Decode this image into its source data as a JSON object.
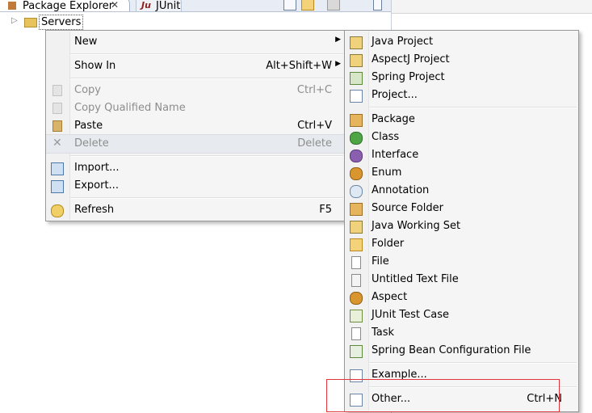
{
  "tabs": {
    "package_explorer": "Package Explorer",
    "close": "✕",
    "junit_badge": "Ju",
    "junit": "JUnit"
  },
  "tree": {
    "expander": "▷",
    "node": "Servers"
  },
  "context_menu": {
    "new": "New",
    "show_in": "Show In",
    "show_in_accel": "Alt+Shift+W",
    "copy": "Copy",
    "copy_accel": "Ctrl+C",
    "copy_qualified_name": "Copy Qualified Name",
    "paste": "Paste",
    "paste_accel": "Ctrl+V",
    "delete": "Delete",
    "delete_accel": "Delete",
    "import": "Import...",
    "export": "Export...",
    "refresh": "Refresh",
    "refresh_accel": "F5",
    "arrow": "▶"
  },
  "new_submenu": {
    "items": [
      "Java Project",
      "AspectJ Project",
      "Spring Project",
      "Project...",
      "Package",
      "Class",
      "Interface",
      "Enum",
      "Annotation",
      "Source Folder",
      "Java Working Set",
      "Folder",
      "File",
      "Untitled Text File",
      "Aspect",
      "JUnit Test Case",
      "Task",
      "Spring Bean Configuration File",
      "Example...",
      "Other..."
    ],
    "other_accel": "Ctrl+N"
  },
  "colors": {
    "highlight_box": "#e0353b",
    "menu_bg": "#f5f5f5"
  }
}
